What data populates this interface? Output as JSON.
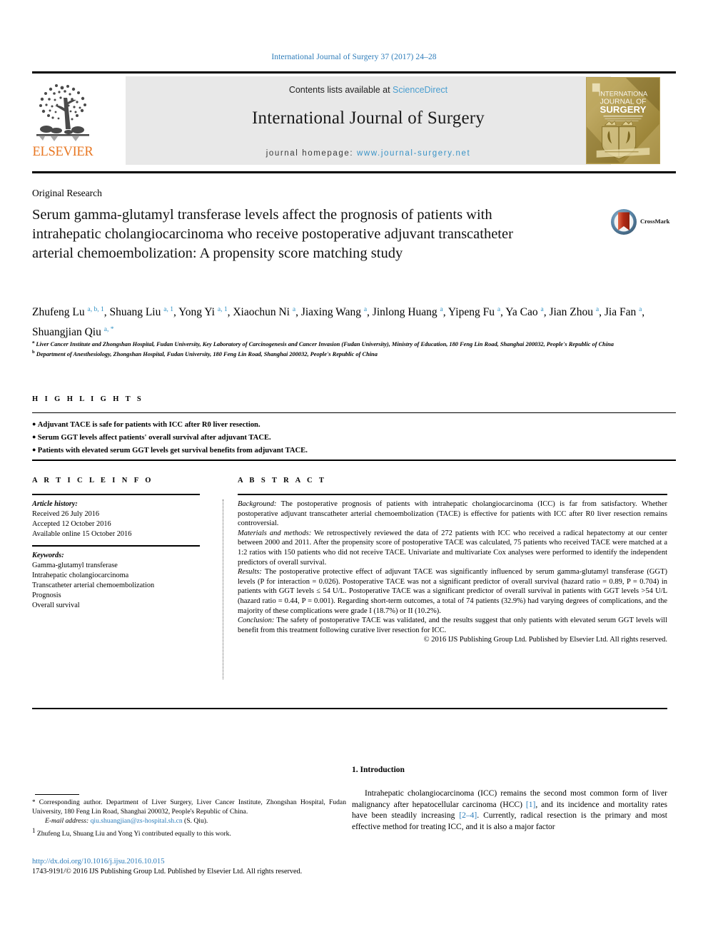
{
  "colors": {
    "link": "#2b7bb9",
    "sciencedirect": "#4a9ed0",
    "homepage_url": "#3a93c6",
    "affil_marker": "#2b8fc4",
    "elsevier_orange": "#e87722"
  },
  "running_head": "International Journal of Surgery 37 (2017) 24–28",
  "banner": {
    "contents_prefix": "Contents lists available at ",
    "sciencedirect": "ScienceDirect",
    "journal_name": "International Journal of Surgery",
    "homepage_label": "journal homepage: ",
    "homepage_url": "www.journal-surgery.net",
    "publisher_logo_text": "ELSEVIER",
    "cover_alt": "journal-cover-thumbnail",
    "cover_title_line1": "INTERNATIONAL",
    "cover_title_line2": "JOURNAL OF",
    "cover_title_line3": "SURGERY"
  },
  "article": {
    "category": "Original Research",
    "title": "Serum gamma-glutamyl transferase levels affect the prognosis of patients with intrahepatic cholangiocarcinoma who receive postoperative adjuvant transcatheter arterial chemoembolization: A propensity score matching study",
    "crossmark_label": "CrossMark"
  },
  "authors": [
    {
      "name": "Zhufeng Lu",
      "marks": "a, b, 1",
      "sep": ","
    },
    {
      "name": "Shuang Liu",
      "marks": "a, 1",
      "sep": ","
    },
    {
      "name": "Yong Yi",
      "marks": "a, 1",
      "sep": ","
    },
    {
      "name": "Xiaochun Ni",
      "marks": "a",
      "sep": ","
    },
    {
      "name": "Jiaxing Wang",
      "marks": "a",
      "sep": ","
    },
    {
      "name": "Jinlong Huang",
      "marks": "a",
      "sep": ","
    },
    {
      "name": "Yipeng Fu",
      "marks": "a",
      "sep": ","
    },
    {
      "name": "Ya Cao",
      "marks": "a",
      "sep": ","
    },
    {
      "name": "Jian Zhou",
      "marks": "a",
      "sep": ","
    },
    {
      "name": "Jia Fan",
      "marks": "a",
      "sep": ","
    },
    {
      "name": "Shuangjian Qiu",
      "marks": "a, *",
      "sep": ""
    }
  ],
  "affiliations": [
    {
      "mark": "a",
      "text": "Liver Cancer Institute and Zhongshan Hospital, Fudan University, Key Laboratory of Carcinogenesis and Cancer Invasion (Fudan University), Ministry of Education, 180 Feng Lin Road, Shanghai 200032, People's Republic of China"
    },
    {
      "mark": "b",
      "text": "Department of Anesthesiology, Zhongshan Hospital, Fudan University, 180 Feng Lin Road, Shanghai 200032, People's Republic of China"
    }
  ],
  "highlights": {
    "heading": "H I G H L I G H T S",
    "items": [
      "Adjuvant TACE is safe for patients with ICC after R0 liver resection.",
      "Serum GGT levels affect patients' overall survival after adjuvant TACE.",
      "Patients with elevated serum GGT levels get survival benefits from adjuvant TACE."
    ]
  },
  "article_info": {
    "heading": "A R T I C L E    I N F O",
    "history_label": "Article history:",
    "history": [
      "Received 26 July 2016",
      "Accepted 12 October 2016",
      "Available online 15 October 2016"
    ],
    "keywords_label": "Keywords:",
    "keywords": [
      "Gamma-glutamyl transferase",
      "Intrahepatic cholangiocarcinoma",
      "Transcatheter arterial chemoembolization",
      "Prognosis",
      "Overall survival"
    ]
  },
  "abstract": {
    "heading": "A B S T R A C T",
    "sections": [
      {
        "label": "Background:",
        "text": " The postoperative prognosis of patients with intrahepatic cholangiocarcinoma (ICC) is far from satisfactory. Whether postoperative adjuvant transcatheter arterial chemoembolization (TACE) is effective for patients with ICC after R0 liver resection remains controversial."
      },
      {
        "label": "Materials and methods:",
        "text": " We retrospectively reviewed the data of 272 patients with ICC who received a radical hepatectomy at our center between 2000 and 2011. After the propensity score of postoperative TACE was calculated, 75 patients who received TACE were matched at a 1:2 ratios with 150 patients who did not receive TACE. Univariate and multivariate Cox analyses were performed to identify the independent predictors of overall survival."
      },
      {
        "label": "Results:",
        "text": " The postoperative protective effect of adjuvant TACE was significantly influenced by serum gamma-glutamyl transferase (GGT) levels (P for interaction = 0.026). Postoperative TACE was not a significant predictor of overall survival (hazard ratio = 0.89, P = 0.704) in patients with GGT levels ≤ 54 U/L. Postoperative TACE was a significant predictor of overall survival in patients with GGT levels >54 U/L (hazard ratio = 0.44, P = 0.001). Regarding short-term outcomes, a total of 74 patients (32.9%) had varying degrees of complications, and the majority of these complications were grade I (18.7%) or II (10.2%)."
      },
      {
        "label": "Conclusion:",
        "text": " The safety of postoperative TACE was validated, and the results suggest that only patients with elevated serum GGT levels will benefit from this treatment following curative liver resection for ICC."
      }
    ],
    "copyright": "© 2016 IJS Publishing Group Ltd. Published by Elsevier Ltd. All rights reserved."
  },
  "introduction": {
    "heading": "1.  Introduction",
    "paragraph_part1": "Intrahepatic cholangiocarcinoma (ICC) remains the second most common form of liver malignancy after hepatocellular carcinoma (HCC) ",
    "ref1": "[1]",
    "paragraph_part2": ", and its incidence and mortality rates have been steadily increasing ",
    "ref2": "[2–4]",
    "paragraph_part3": ". Currently, radical resection is the primary and most effective method for treating ICC, and it is also a major factor"
  },
  "footnotes": {
    "corresponding_marker": "*",
    "corresponding_text": " Corresponding author. Department of Liver Surgery, Liver Cancer Institute, Zhongshan Hospital, Fudan University, 180 Feng Lin Road, Shanghai 200032, People's Republic of China.",
    "email_label": "E-mail address:",
    "email": "qiu.shuangjian@zs-hospital.sh.cn",
    "email_suffix": " (S. Qiu).",
    "equal_marker": "1",
    "equal_text": " Zhufeng Lu, Shuang Liu and Yong Yi contributed equally to this work."
  },
  "footer": {
    "doi": "http://dx.doi.org/10.1016/j.ijsu.2016.10.015",
    "issn_line": "1743-9191/© 2016 IJS Publishing Group Ltd. Published by Elsevier Ltd. All rights reserved."
  }
}
